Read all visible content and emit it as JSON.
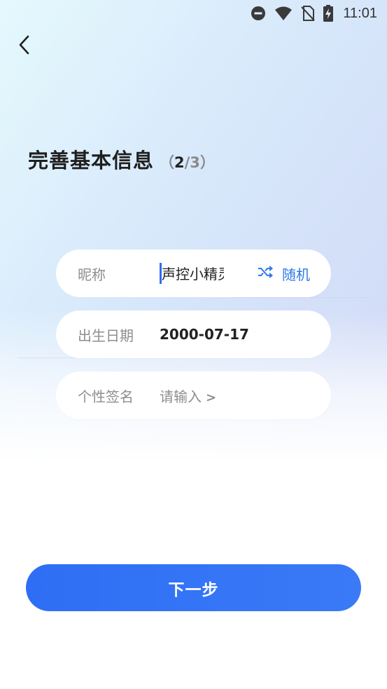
{
  "status_bar": {
    "time": "11:01",
    "icons": [
      "do-not-disturb-icon",
      "wifi-icon",
      "no-sim-icon",
      "battery-charging-icon"
    ]
  },
  "header": {
    "back_icon": "chevron-left-icon",
    "title": "完善基本信息",
    "step_open": "（",
    "step_current": "2",
    "step_total": "/3",
    "step_close": "）"
  },
  "form": {
    "nickname": {
      "label": "昵称",
      "value": "声控小精灵",
      "random_label": "随机",
      "random_icon": "shuffle-icon"
    },
    "birthday": {
      "label": "出生日期",
      "value": "2000-07-17"
    },
    "signature": {
      "label": "个性签名",
      "placeholder": "请输入",
      "chevron": ">"
    }
  },
  "footer": {
    "next_label": "下一步"
  },
  "colors": {
    "accent": "#2f6bf0",
    "link": "#2f79e6",
    "label_gray": "#8e8e8e",
    "text_dark": "#222222"
  }
}
